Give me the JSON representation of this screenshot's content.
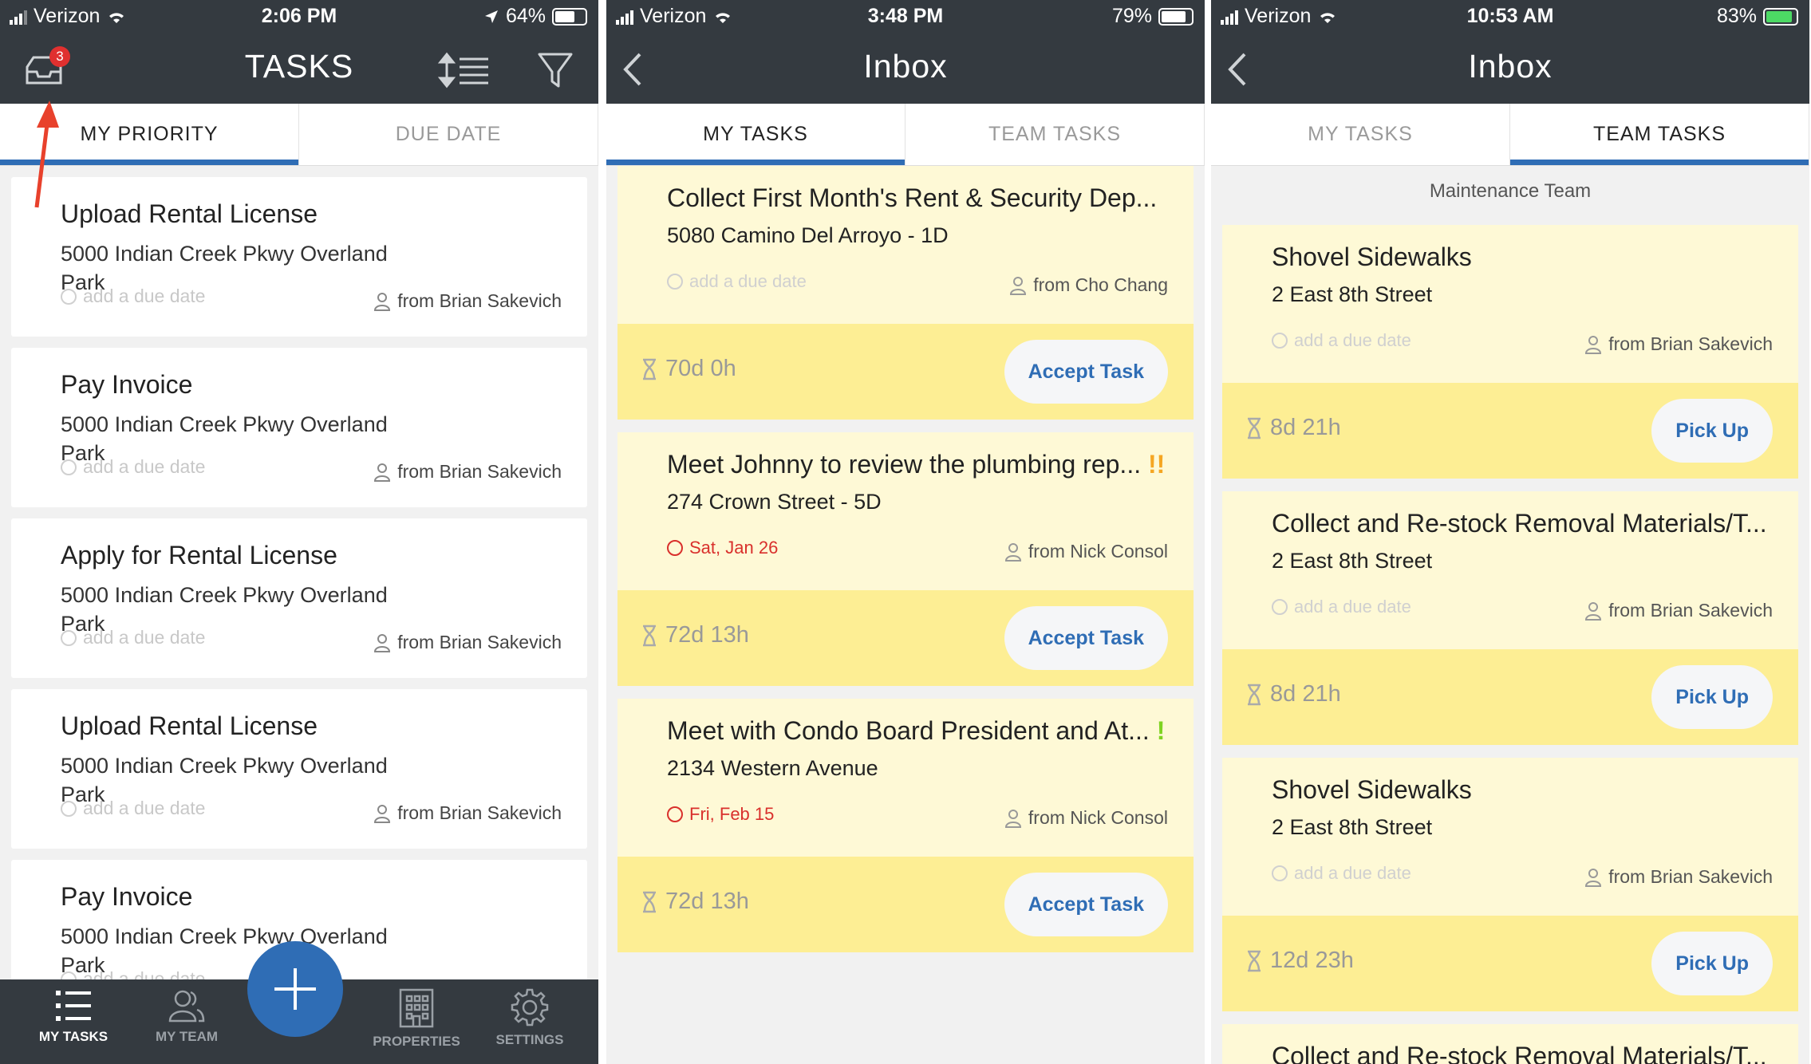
{
  "screens": [
    {
      "status": {
        "carrier": "Verizon",
        "time": "2:06 PM",
        "battery": "64%"
      },
      "title": "TASKS",
      "inbox_badge": "3",
      "tabs": [
        "MY PRIORITY",
        "DUE DATE"
      ],
      "cards": [
        {
          "title": "Upload Rental License",
          "address": "5000 Indian Creek Pkwy Overland Park",
          "due": "add a due date",
          "from": "from Brian Sakevich"
        },
        {
          "title": "Pay Invoice",
          "address": "5000 Indian Creek Pkwy Overland Park",
          "due": "add a due date",
          "from": "from Brian Sakevich"
        },
        {
          "title": "Apply for Rental License",
          "address": "5000 Indian Creek Pkwy Overland Park",
          "due": "add a due date",
          "from": "from Brian Sakevich"
        },
        {
          "title": "Upload Rental License",
          "address": "5000 Indian Creek Pkwy Overland Park",
          "due": "add a due date",
          "from": "from Brian Sakevich"
        },
        {
          "title": "Pay Invoice",
          "address": "5000 Indian Creek Pkwy Overland Park",
          "due": "add a due date",
          "from": ""
        }
      ],
      "bottom_nav": [
        "MY TASKS",
        "MY TEAM",
        "PROPERTIES",
        "SETTINGS"
      ]
    },
    {
      "status": {
        "carrier": "Verizon",
        "time": "3:48 PM",
        "battery": "79%"
      },
      "title": "Inbox",
      "tabs": [
        "MY TASKS",
        "TEAM TASKS"
      ],
      "cards": [
        {
          "title": "Collect First Month's Rent & Security Dep...",
          "priority": "",
          "address": "5080 Camino Del Arroyo - 1D",
          "due": "add a due date",
          "from": "from Cho Chang",
          "timer": "70d 0h",
          "action": "Accept Task"
        },
        {
          "title": "Meet Johnny to review the plumbing rep...",
          "priority": "!!",
          "address": "274 Crown Street - 5D",
          "due": "Sat, Jan 26",
          "from": "from Nick Consol",
          "timer": "72d 13h",
          "action": "Accept Task"
        },
        {
          "title": "Meet with Condo Board President and At...",
          "priority": "!",
          "address": "2134 Western Avenue",
          "due": "Fri, Feb 15",
          "from": "from Nick Consol",
          "timer": "72d 13h",
          "action": "Accept Task"
        }
      ]
    },
    {
      "status": {
        "carrier": "Verizon",
        "time": "10:53 AM",
        "battery": "83%"
      },
      "title": "Inbox",
      "tabs": [
        "MY TASKS",
        "TEAM TASKS"
      ],
      "section": "Maintenance Team",
      "cards": [
        {
          "title": "Shovel Sidewalks",
          "address": "2 East 8th Street",
          "due": "add a due date",
          "from": "from Brian Sakevich",
          "timer": "8d 21h",
          "action": "Pick Up"
        },
        {
          "title": "Collect and Re-stock Removal Materials/T...",
          "address": "2 East 8th Street",
          "due": "add a due date",
          "from": "from Brian Sakevich",
          "timer": "8d 21h",
          "action": "Pick Up"
        },
        {
          "title": "Shovel Sidewalks",
          "address": "2 East 8th Street",
          "due": "add a due date",
          "from": "from Brian Sakevich",
          "timer": "12d 23h",
          "action": "Pick Up"
        },
        {
          "title": "Collect and Re-stock Removal Materials/T...",
          "address": "",
          "due": "",
          "from": "",
          "timer": "",
          "action": ""
        }
      ]
    }
  ],
  "colors": {
    "header": "#343a40",
    "accent": "#2f6db5",
    "card_yellow": "#fef9d6",
    "card_yellow_dark": "#fdee94",
    "due_red": "#d9302c",
    "annotation_arrow": "#e8412c"
  }
}
